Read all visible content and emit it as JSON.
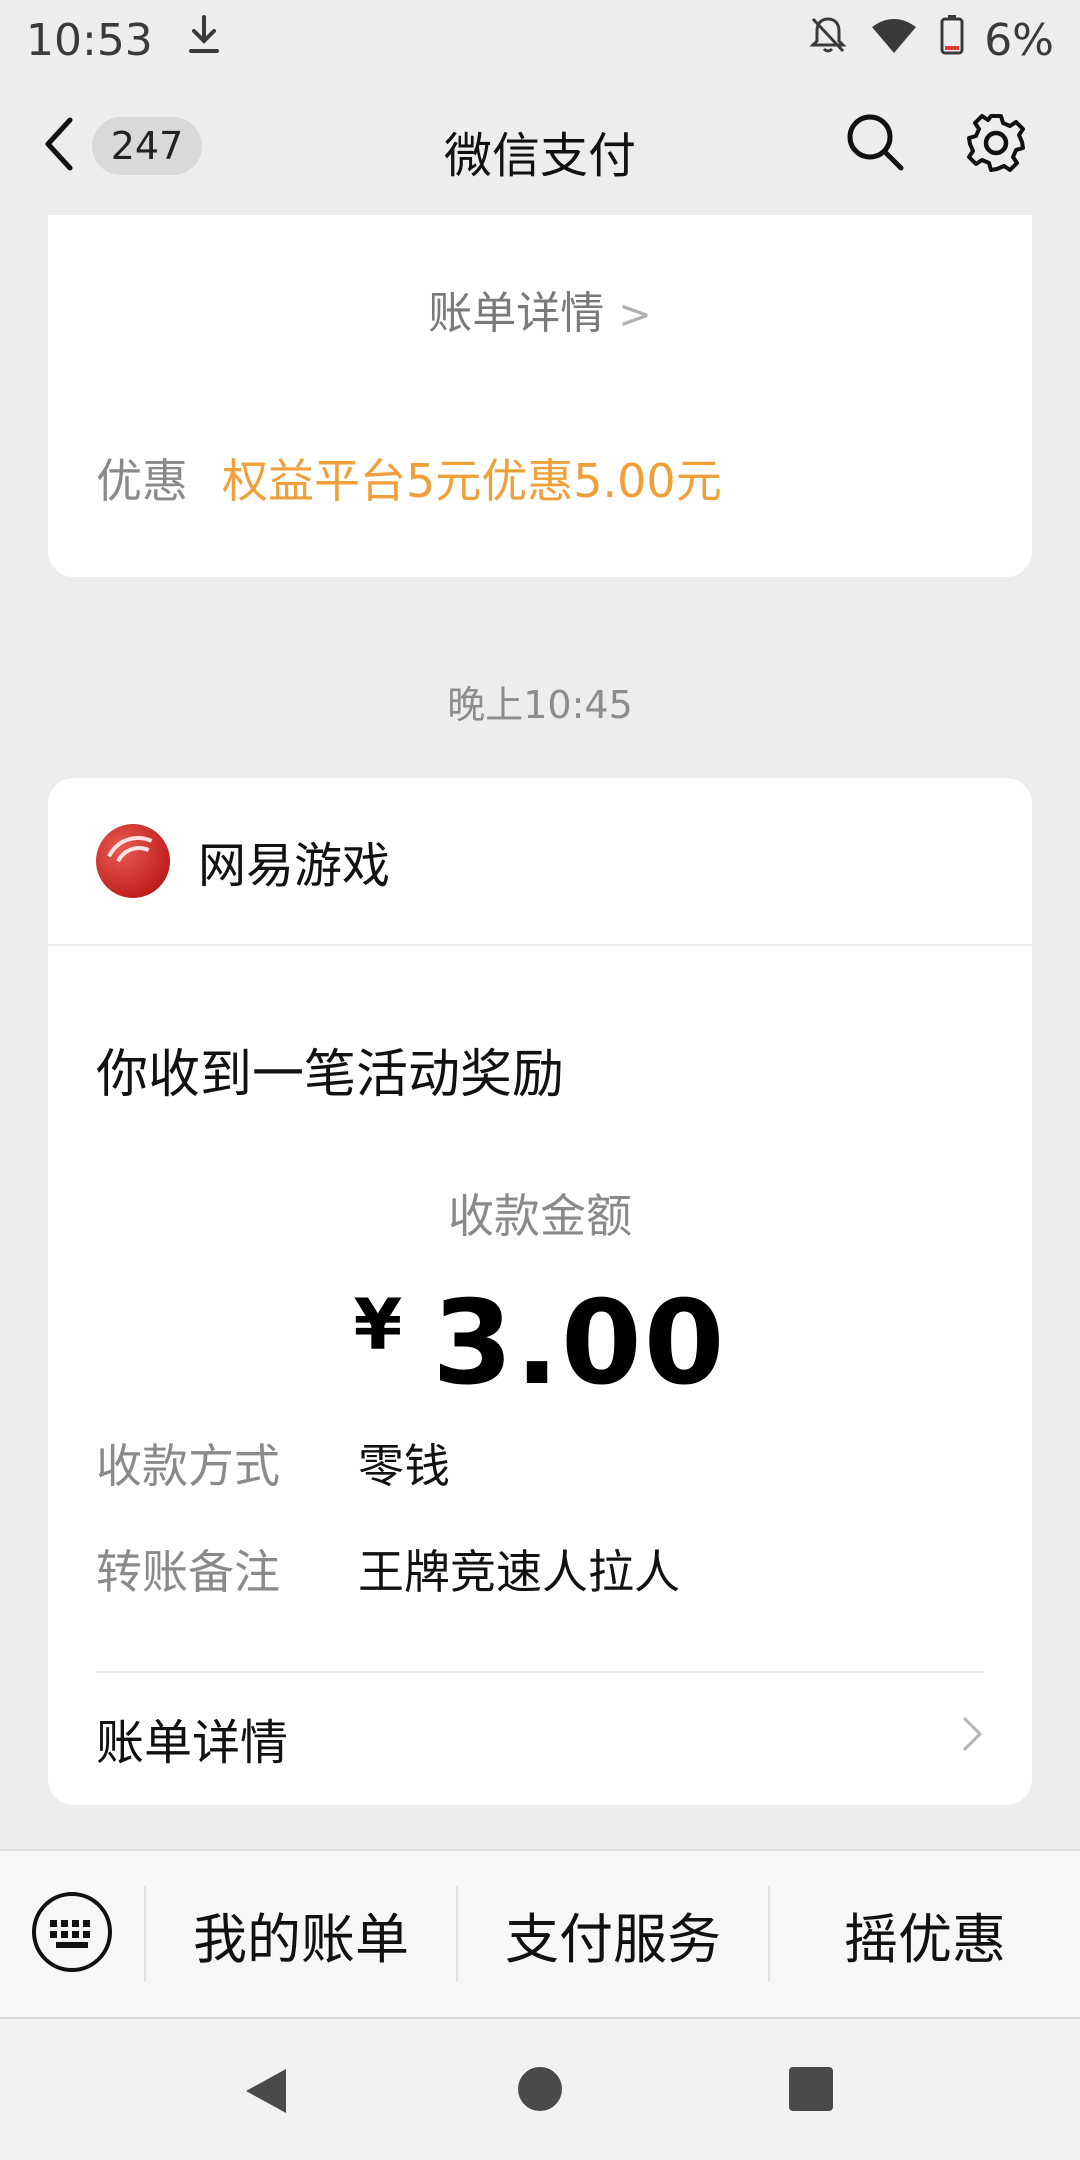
{
  "status_bar": {
    "time": "10:53",
    "battery": "6%",
    "icons": [
      "download-icon",
      "bell-off-icon",
      "wifi-icon",
      "battery-icon"
    ]
  },
  "nav": {
    "back_count": "247",
    "title": "微信支付",
    "icons": [
      "back-chevron-icon",
      "search-icon",
      "gear-icon"
    ]
  },
  "top_card": {
    "bill_detail": "账单详情",
    "discount_label": "优惠",
    "discount_value": "权益平台5元优惠5.00元"
  },
  "time_label": "晚上10:45",
  "main_card": {
    "merchant": "网易游戏",
    "title": "你收到一笔活动奖励",
    "amount_label": "收款金额",
    "currency": "¥",
    "amount": "3.00",
    "rows": [
      {
        "label": "收款方式",
        "value": "零钱"
      },
      {
        "label": "转账备注",
        "value": "王牌竞速人拉人"
      }
    ],
    "bill_detail": "账单详情"
  },
  "bottom_menu": {
    "items": [
      "我的账单",
      "支付服务",
      "摇优惠"
    ]
  },
  "colors": {
    "accent_orange": "#f0a03a",
    "background": "#ededed",
    "card": "#ffffff"
  }
}
